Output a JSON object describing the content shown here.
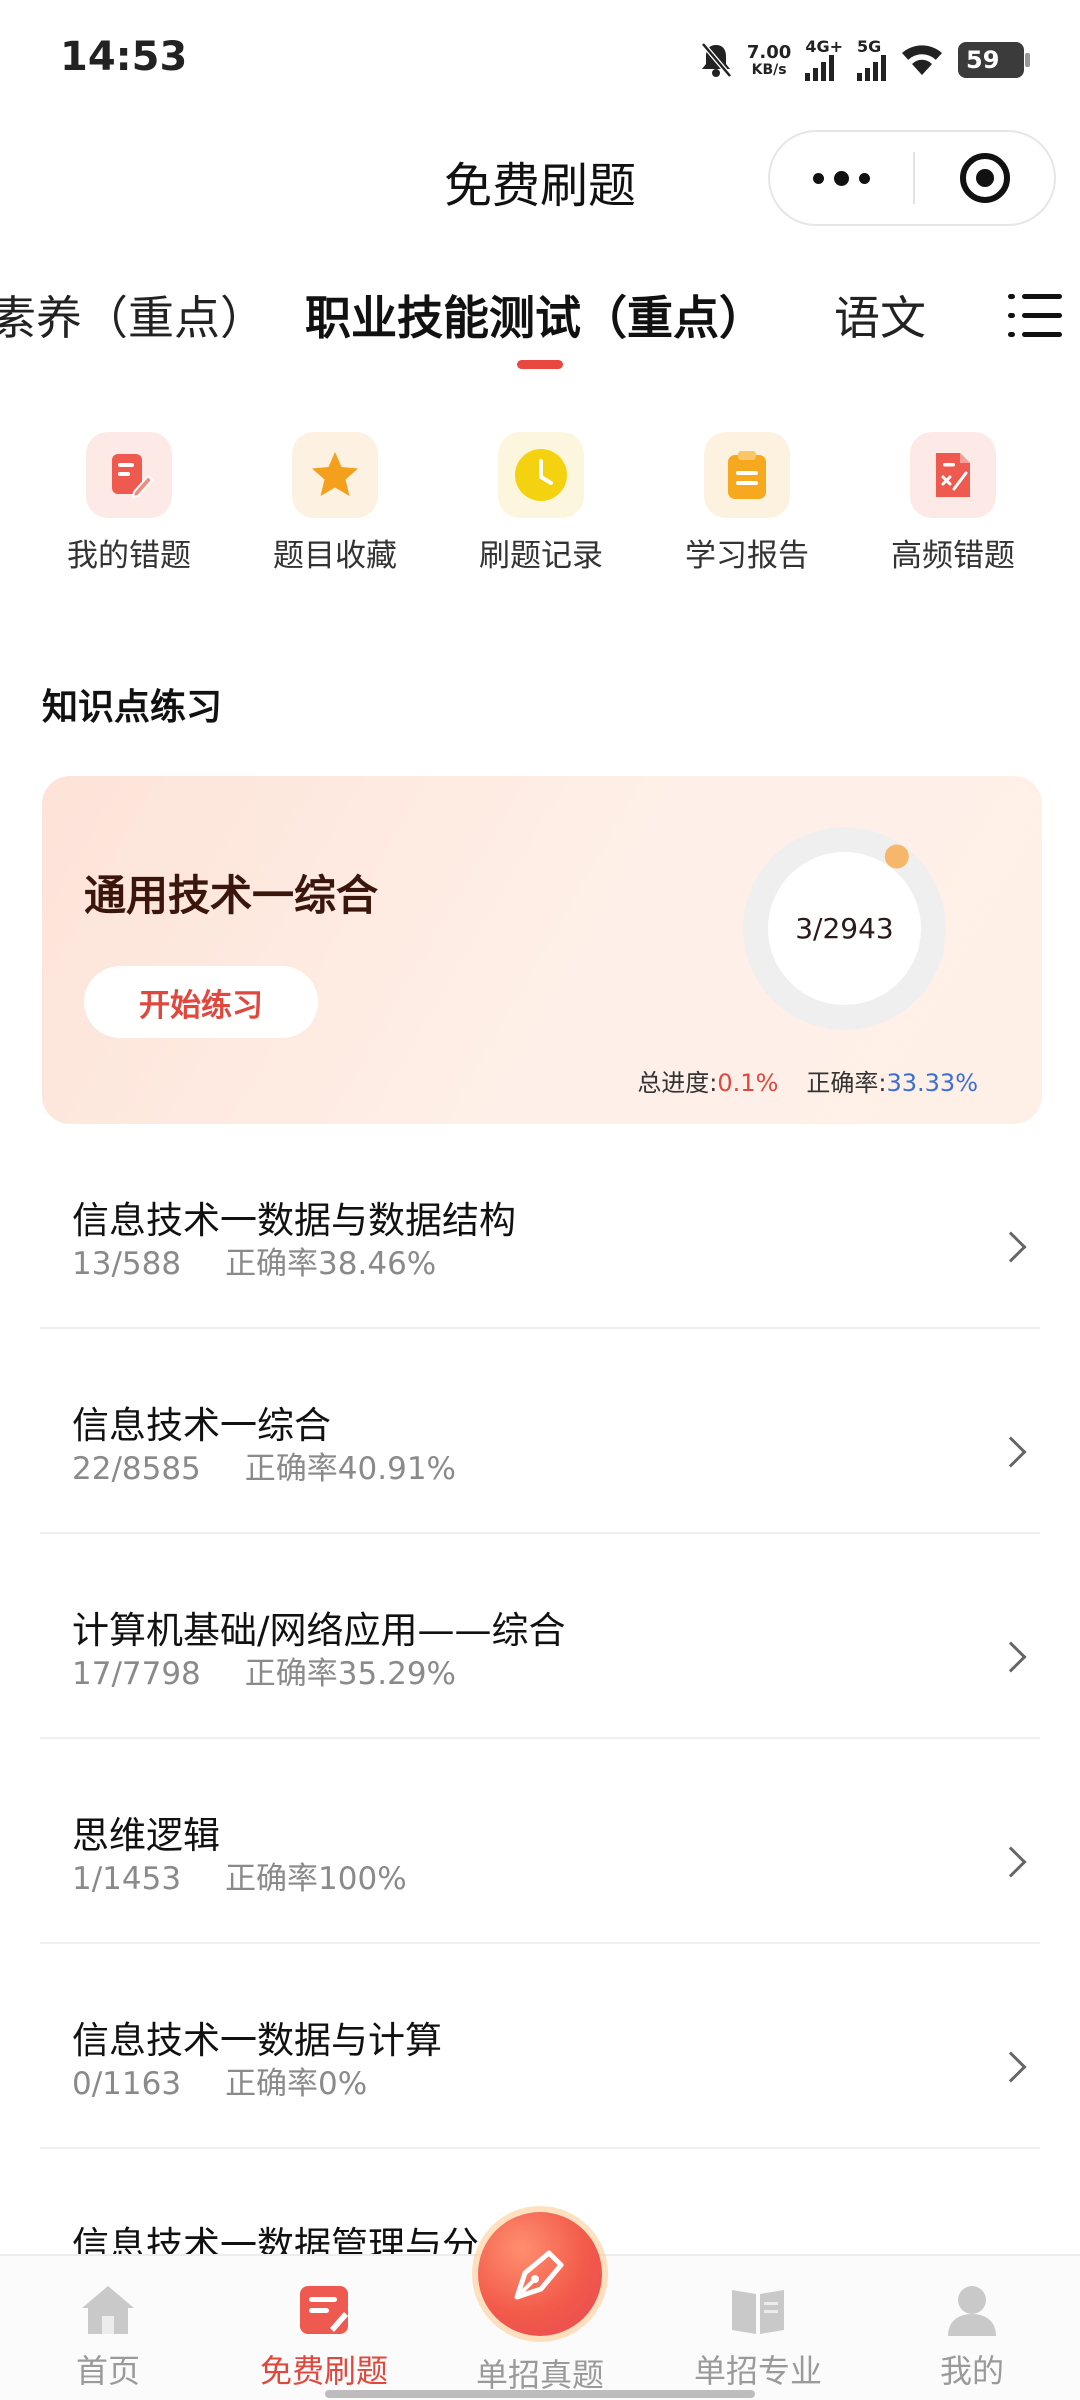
{
  "status_bar": {
    "time": "14:53",
    "net_speed_value": "7.00",
    "net_speed_unit": "KB/s",
    "signal1_label": "4G+",
    "signal2_label": "5G",
    "battery": "59"
  },
  "nav": {
    "title": "免费刷题"
  },
  "tabs": [
    {
      "label": "素养（重点）"
    },
    {
      "label": "职业技能测试（重点）",
      "active": true
    },
    {
      "label": "语文"
    }
  ],
  "shortcuts": [
    {
      "label": "我的错题",
      "icon": "wrong-questions-icon",
      "color": "#ee5a50",
      "bg": "#fde9e6"
    },
    {
      "label": "题目收藏",
      "icon": "star-icon",
      "color": "#f4a01c",
      "bg": "#fdf1e1"
    },
    {
      "label": "刷题记录",
      "icon": "clock-icon",
      "color": "#f5d20f",
      "bg": "#fdf6df"
    },
    {
      "label": "学习报告",
      "icon": "clipboard-icon",
      "color": "#f6a91f",
      "bg": "#fdf2e0"
    },
    {
      "label": "高频错题",
      "icon": "high-frequency-errors-icon",
      "color": "#ee5a50",
      "bg": "#fde9e6"
    }
  ],
  "section_title": "知识点练习",
  "featured": {
    "title": "通用技术一综合",
    "button": "开始练习",
    "progress_text": "3/2943",
    "progress_fraction": 0.001,
    "total_label": "总进度:",
    "total_value": "0.1%",
    "accuracy_label": "正确率:",
    "accuracy_value": "33.33%"
  },
  "topics": [
    {
      "title": "信息技术一数据与数据结构",
      "count": "13/588",
      "accuracy": "正确率38.46%"
    },
    {
      "title": "信息技术一综合",
      "count": "22/8585",
      "accuracy": "正确率40.91%"
    },
    {
      "title": "计算机基础/网络应用——综合",
      "count": "17/7798",
      "accuracy": "正确率35.29%"
    },
    {
      "title": "思维逻辑",
      "count": "1/1453",
      "accuracy": "正确率100%"
    },
    {
      "title": "信息技术一数据与计算",
      "count": "0/1163",
      "accuracy": "正确率0%"
    },
    {
      "title": "信息技术一数据管理与分",
      "count": "",
      "accuracy": ""
    }
  ],
  "tabbar": [
    {
      "label": "首页",
      "icon": "home-icon"
    },
    {
      "label": "免费刷题",
      "icon": "practice-icon",
      "active": true
    },
    {
      "label": "单招真题",
      "icon": "pen-icon"
    },
    {
      "label": "单招专业",
      "icon": "book-icon"
    },
    {
      "label": "我的",
      "icon": "profile-icon"
    }
  ],
  "colors": {
    "accent": "#e0483e",
    "accuracy_blue": "#3b6fd6",
    "progress_dot": "#f7b76a"
  }
}
